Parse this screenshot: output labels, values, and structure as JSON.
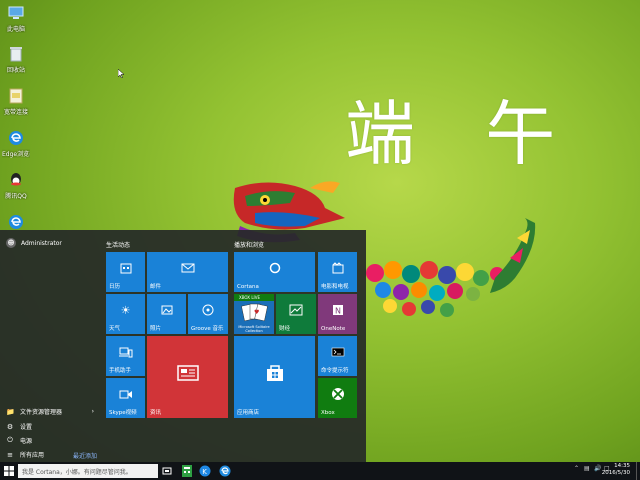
{
  "wallpaper": {
    "calligraphy": "端 午",
    "colors": {
      "bg_light": "#b6d84a",
      "bg_dark": "#4f7e14"
    }
  },
  "desktop_icons": [
    {
      "label": "此电脑",
      "icon": "computer-icon",
      "color": "#5aa9e6"
    },
    {
      "label": "回收站",
      "icon": "recycle-bin-icon",
      "color": "#cfd8dc"
    },
    {
      "label": "宽带连接",
      "icon": "broadband-icon",
      "color": "#e8d36a"
    },
    {
      "label": "Edge浏览器",
      "icon": "edge-icon",
      "color": "#1f8be0"
    },
    {
      "label": "腾讯QQ",
      "icon": "qq-icon",
      "color": "#222222"
    },
    {
      "label": "",
      "icon": "ie-icon",
      "color": "#1f8be0"
    }
  ],
  "start_menu": {
    "user": {
      "name": "Administrator"
    },
    "left_items": [
      {
        "label": "文件资源管理器",
        "icon": "folder-icon",
        "has_arrow": true
      },
      {
        "label": "设置",
        "icon": "gear-icon",
        "has_arrow": false
      },
      {
        "label": "电源",
        "icon": "power-icon",
        "has_arrow": false
      },
      {
        "label": "所有应用",
        "icon": "apps-icon",
        "has_arrow": false
      }
    ],
    "recent_label": "最近添加",
    "groups": [
      {
        "title": "生活动态"
      },
      {
        "title": "播放和浏览"
      }
    ],
    "tiles": {
      "calendar": "日历",
      "mail": "邮件",
      "weather": "天气",
      "photos": "照片",
      "groove": "Groove 音乐",
      "phone": "手机助手",
      "skype": "Skype视频",
      "news": "资讯",
      "cortana": "Cortana",
      "movies": "电影和电视",
      "xbox_live": "XBOX LIVE",
      "solitaire": "Microsoft Solitaire Collection",
      "money": "财经",
      "onenote": "OneNote",
      "store": "应用商店",
      "cmd": "命令提示符",
      "xbox": "Xbox"
    }
  },
  "taskbar": {
    "search_placeholder": "我是 Cortana，小娜。有问题尽管问我。",
    "time": "14:35",
    "date": "2016/5/30",
    "tray_icons": [
      "chevron-up-icon",
      "network-icon",
      "volume-icon",
      "ime-icon",
      "notification-icon"
    ]
  }
}
